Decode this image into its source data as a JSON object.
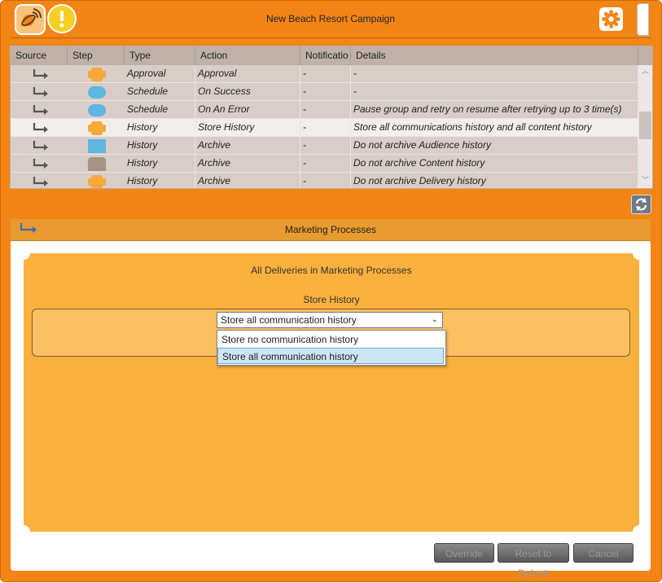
{
  "window": {
    "title": "New Beach Resort Campaign",
    "icons": [
      "satellite-icon",
      "warning-icon",
      "gear-icon"
    ]
  },
  "grid": {
    "columns": [
      "Source",
      "Step",
      "Type",
      "Action",
      "Notificatio",
      "Details"
    ],
    "rows": [
      {
        "step_shape": "cross",
        "step_color": "#f8a93a",
        "type": "Approval",
        "action": "Approval",
        "notification": "-",
        "details": "-"
      },
      {
        "step_shape": "pill",
        "step_color": "#5fb6e0",
        "type": "Schedule",
        "action": "On Success",
        "notification": "-",
        "details": "-"
      },
      {
        "step_shape": "pill",
        "step_color": "#5fb6e0",
        "type": "Schedule",
        "action": "On An Error",
        "notification": "-",
        "details": "Pause group and retry on resume after retrying up to 3 time(s)"
      },
      {
        "step_shape": "cross",
        "step_color": "#f8a93a",
        "type": "History",
        "action": "Store History",
        "notification": "-",
        "details": "Store all communications history and all content history"
      },
      {
        "step_shape": "rect",
        "step_color": "#5fb6e0",
        "type": "History",
        "action": "Archive",
        "notification": "-",
        "details": "Do not archive Audience history"
      },
      {
        "step_shape": "tag",
        "step_color": "#a39386",
        "type": "History",
        "action": "Archive",
        "notification": "-",
        "details": "Do not archive Content history"
      },
      {
        "step_shape": "cross",
        "step_color": "#f8a93a",
        "type": "History",
        "action": "Archive",
        "notification": "-",
        "details": "Do not archive Delivery history"
      }
    ],
    "selected_row": 3
  },
  "panel": {
    "title": "Marketing Processes",
    "box_title": "All Deliveries in Marketing Processes",
    "section_title": "Store History",
    "select_value": "Store all communication history",
    "options": [
      "Store no communication history",
      "Store all communication history"
    ],
    "highlighted_option": 1
  },
  "buttons": {
    "override": "Override",
    "reset": "Reset to Default",
    "cancel": "Cancel"
  },
  "colors": {
    "accent": "#f28516",
    "panel_header": "#e79a2f",
    "content_box": "#fbb13e"
  }
}
